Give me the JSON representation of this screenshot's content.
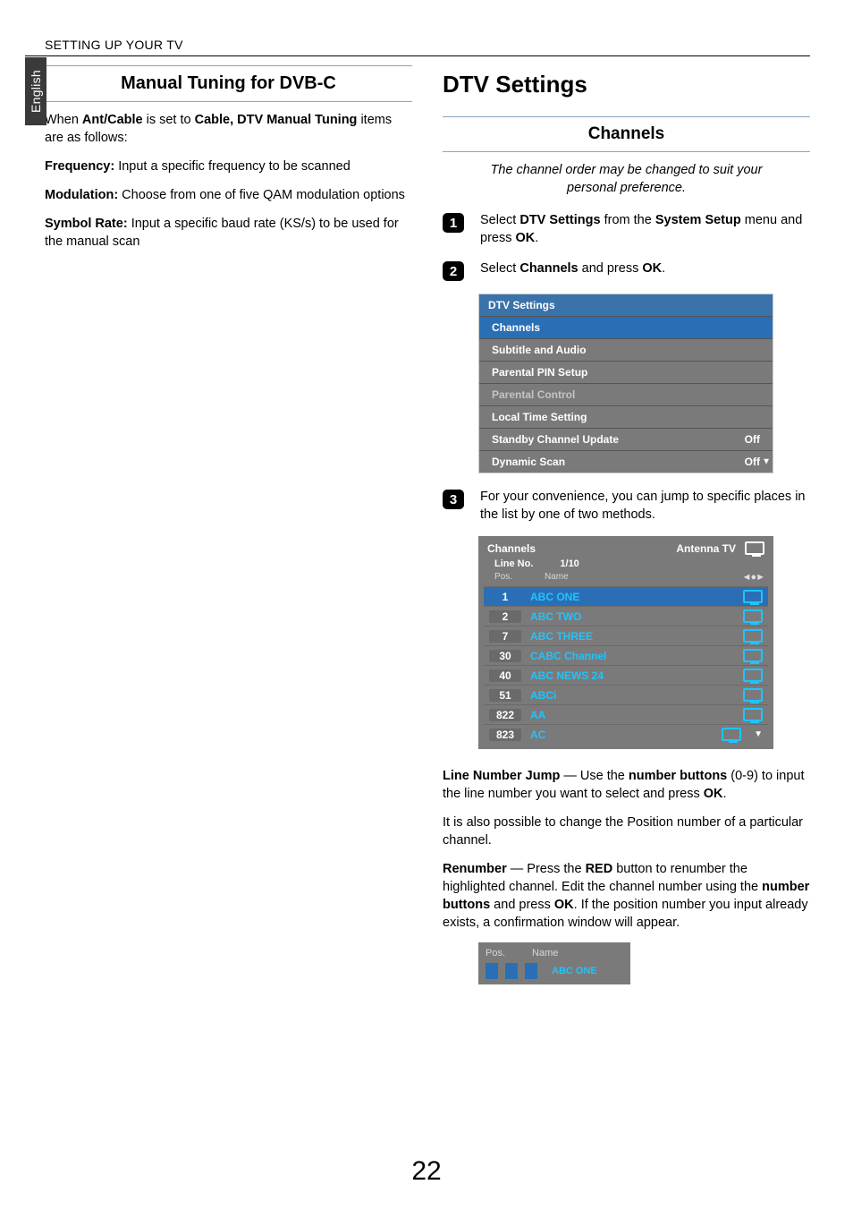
{
  "running_head": "SETTING UP YOUR TV",
  "lang_tab": "English",
  "page_number": "22",
  "left": {
    "heading": "Manual Tuning for DVB-C",
    "intro_pre": "When ",
    "intro_b1": "Ant/Cable",
    "intro_mid": " is set to ",
    "intro_b2": "Cable, DTV Manual Tuning",
    "intro_post": " items are as follows:",
    "freq_label": "Frequency:",
    "freq_text": " Input a specific frequency to be scanned",
    "mod_label": "Modulation:",
    "mod_text": " Choose from one of five QAM modulation options",
    "sym_label": "Symbol Rate:",
    "sym_text": " Input a specific baud rate (KS/s) to be used for the manual scan"
  },
  "right": {
    "heading": "DTV Settings",
    "sub_heading": "Channels",
    "intro_italic": "The channel order may be changed to suit your personal preference.",
    "step1_pre": "Select ",
    "step1_b1": "DTV Settings",
    "step1_mid": " from the ",
    "step1_b2": "System Setup",
    "step1_post": " menu and press ",
    "step1_b3": "OK",
    "step1_end": ".",
    "step2_pre": "Select ",
    "step2_b1": "Channels",
    "step2_mid": " and press ",
    "step2_b2": "OK",
    "step2_end": ".",
    "menu": {
      "title": "DTV Settings",
      "rows": [
        {
          "label": "Channels",
          "value": "",
          "hl": true
        },
        {
          "label": "Subtitle and Audio",
          "value": ""
        },
        {
          "label": "Parental PIN Setup",
          "value": ""
        },
        {
          "label": "Parental Control",
          "value": "",
          "dim": true
        },
        {
          "label": "Local Time Setting",
          "value": ""
        },
        {
          "label": "Standby Channel Update",
          "value": "Off"
        },
        {
          "label": "Dynamic Scan",
          "value": "Off",
          "arrow": true
        }
      ]
    },
    "step3_text": "For your convenience, you can jump to specific places in the list by one of two methods.",
    "channels_box": {
      "title": "Channels",
      "source": "Antenna TV",
      "line_no_label": "Line No.",
      "line_no_value": "1/10",
      "col_pos": "Pos.",
      "col_name": "Name",
      "rows": [
        {
          "pos": "1",
          "name": "ABC ONE",
          "hl": true
        },
        {
          "pos": "2",
          "name": "ABC TWO"
        },
        {
          "pos": "7",
          "name": "ABC THREE"
        },
        {
          "pos": "30",
          "name": "CABC Channel"
        },
        {
          "pos": "40",
          "name": "ABC NEWS 24"
        },
        {
          "pos": "51",
          "name": "ABCi"
        },
        {
          "pos": "822",
          "name": "AA"
        },
        {
          "pos": "823",
          "name": "AC",
          "arrow": true
        }
      ]
    },
    "lnj_b": "Line Number Jump",
    "lnj_mid": " — Use the ",
    "lnj_b2": "number buttons",
    "lnj_post": " (0-9) to input the line number you want to select and press ",
    "lnj_b3": "OK",
    "lnj_end": ".",
    "pos_text": "It is also possible to change the Position number of a particular channel.",
    "ren_b": "Renumber",
    "ren_mid": " — Press the ",
    "ren_b2": "RED",
    "ren_mid2": " button to renumber the highlighted channel. Edit the channel number using the ",
    "ren_b3": "number buttons",
    "ren_mid3": " and press ",
    "ren_b4": "OK",
    "ren_post": ". If the position number you input already exists, a confirmation window will appear.",
    "renum_box": {
      "col_pos": "Pos.",
      "col_name": "Name",
      "name": "ABC ONE"
    }
  }
}
